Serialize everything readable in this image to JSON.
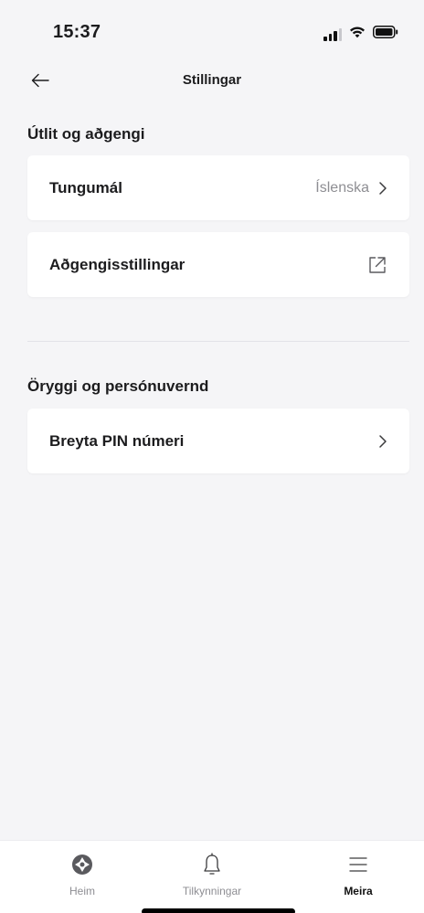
{
  "status_bar": {
    "time": "15:37"
  },
  "header": {
    "title": "Stillingar"
  },
  "sections": [
    {
      "title": "Útlit og aðgengi",
      "items": [
        {
          "label": "Tungumál",
          "value": "Íslenska",
          "icon": "chevron-right-icon"
        },
        {
          "label": "Aðgengisstillingar",
          "icon": "external-link-icon"
        }
      ]
    },
    {
      "title": "Öryggi og persónuvernd",
      "items": [
        {
          "label": "Breyta PIN númeri",
          "icon": "chevron-right-icon"
        }
      ]
    }
  ],
  "tab_bar": {
    "tabs": [
      {
        "label": "Heim",
        "icon": "home-logo-icon",
        "active": false
      },
      {
        "label": "Tilkynningar",
        "icon": "bell-icon",
        "active": false
      },
      {
        "label": "Meira",
        "icon": "menu-icon",
        "active": true
      }
    ]
  },
  "colors": {
    "background": "#f5f5f7",
    "card": "#ffffff",
    "text": "#1c1c1e",
    "muted": "#8e8e93",
    "divider": "#e3e3e8"
  }
}
